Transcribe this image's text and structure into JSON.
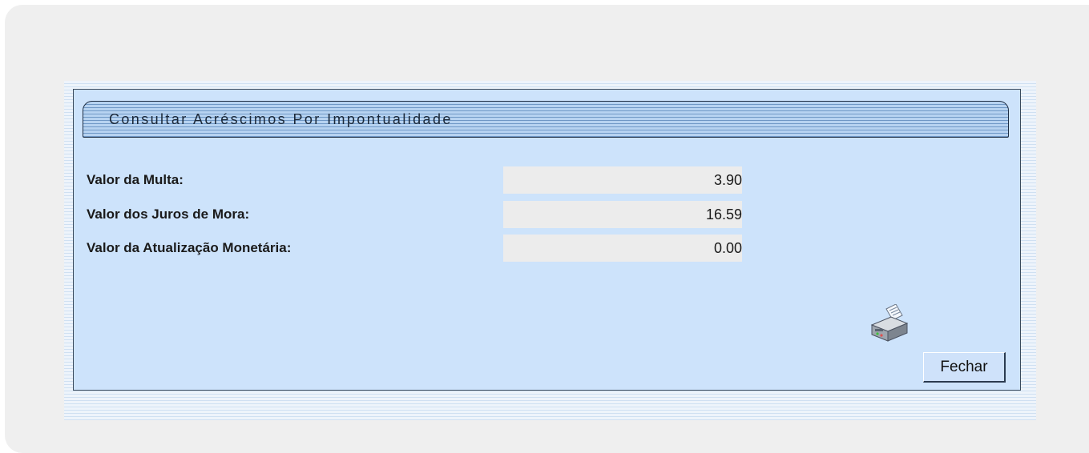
{
  "panel": {
    "title": "Consultar Acréscimos Por Impontualidade"
  },
  "fields": [
    {
      "label": "Valor da Multa:",
      "value": "3.90"
    },
    {
      "label": "Valor dos Juros de Mora:",
      "value": "16.59"
    },
    {
      "label": "Valor da Atualização Monetária:",
      "value": "0.00"
    }
  ],
  "actions": {
    "print_icon": "printer-icon",
    "close_label": "Fechar"
  },
  "colors": {
    "panel_bg": "#cde3fb",
    "title_bar": "#a9c9ec",
    "value_bg": "#ececec",
    "outer_bg": "#efefef"
  }
}
